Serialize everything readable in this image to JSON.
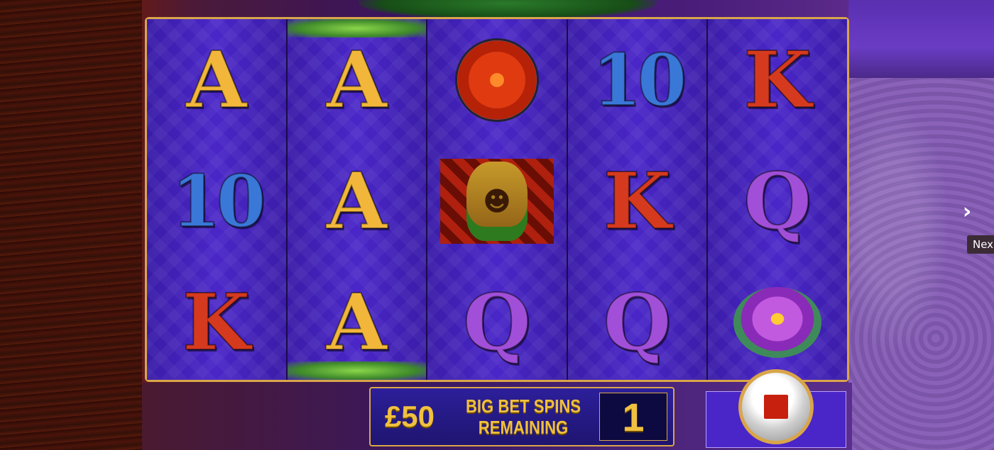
{
  "reels": [
    [
      "A",
      "10",
      "K"
    ],
    [
      "A",
      "A",
      "A"
    ],
    [
      "flower",
      "tiki",
      "Q"
    ],
    [
      "10",
      "K",
      "Q"
    ],
    [
      "K",
      "Q",
      "lotus"
    ]
  ],
  "highlighted_reel": 1,
  "bet_panel": {
    "amount": "£50",
    "label_line1": "BIG BET SPINS",
    "label_line2": "REMAINING",
    "count": "1"
  },
  "stop_button": {
    "icon": "stop-square-icon"
  },
  "navigation": {
    "next_icon": "chevron-right-icon",
    "next_tooltip": "Nex"
  },
  "colors": {
    "frame_gold": "#d9a54a",
    "reel_purple": "#4a26c8",
    "stop_red": "#c8200e",
    "label_gold": "#f0c040"
  }
}
